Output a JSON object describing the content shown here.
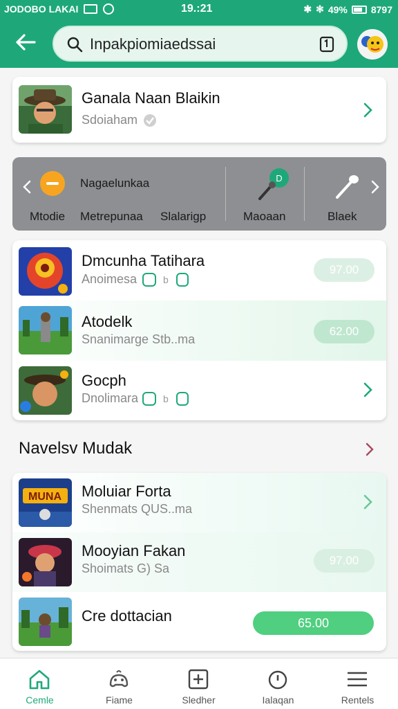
{
  "status_bar": {
    "left_text": "JODOBO LAKAI",
    "time": "19.:21",
    "battery_text": "49%",
    "right_text": "8797"
  },
  "search": {
    "value": "Inpakpiomiaedssai"
  },
  "featured": {
    "title": "Ganala Naan Blaikin",
    "subtitle": "Sdoiaham"
  },
  "strip": {
    "heading": "Nagaelunkaa",
    "labels": [
      "Mtodie",
      "Metrepunaa",
      "Slalarigp",
      "Maoaan",
      "Blaek"
    ],
    "badge": "D"
  },
  "list1": [
    {
      "title": "Dmcunha Tatihara",
      "subtitle": "Anoimesa",
      "price": "97.00"
    },
    {
      "title": "Atodelk",
      "subtitle": "Snanimarge Stb..ma",
      "price": "62.00"
    },
    {
      "title": "Gocph",
      "subtitle": "Dnolimara"
    }
  ],
  "section": {
    "title": "Navelsv Mudak"
  },
  "list2": [
    {
      "title": "Moluiar Forta",
      "subtitle": "Shenmats QUS..ma",
      "thumb_text": "MUNA"
    },
    {
      "title": "Mooyian Fakan",
      "subtitle": "Shoimats G) Sa",
      "price": "97.00"
    },
    {
      "title": "Cre dottacian",
      "price": "65.00"
    }
  ],
  "nav": [
    {
      "label": "Cemle",
      "icon": "home-icon"
    },
    {
      "label": "Fiame",
      "icon": "game-controller-icon"
    },
    {
      "label": "Sledher",
      "icon": "plus-box-icon"
    },
    {
      "label": "Ialaqan",
      "icon": "timer-icon"
    },
    {
      "label": "Rentels",
      "icon": "menu-icon"
    }
  ],
  "colors": {
    "header": "#1ea87a",
    "accent": "#1ea87a",
    "price_active": "#4fcf7f",
    "price_faded": "#d4efe0",
    "strip": "#8d8f92"
  }
}
